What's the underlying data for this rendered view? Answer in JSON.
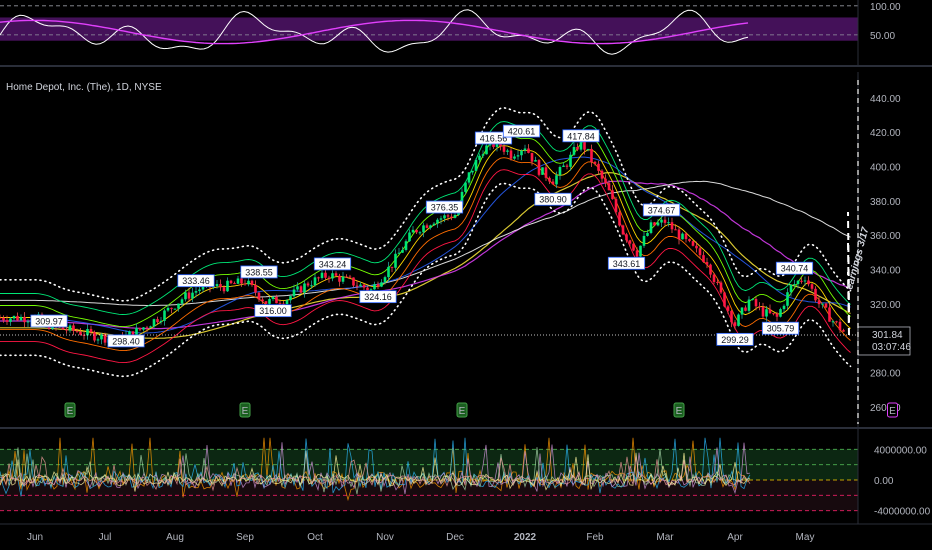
{
  "chart_data": [
    {
      "type": "line",
      "panel": "oscillator",
      "yticks": [
        50,
        100
      ],
      "band": [
        40,
        80
      ]
    },
    {
      "type": "candlestick",
      "panel": "price",
      "title": "Home Depot, Inc. (The), 1D, NYSE",
      "ylim": [
        250,
        455
      ],
      "yticks": [
        260,
        280,
        300,
        320,
        340,
        360,
        380,
        400,
        420,
        440
      ],
      "xticks": [
        "Jun",
        "Jul",
        "Aug",
        "Sep",
        "Oct",
        "Nov",
        "Dec",
        "2022",
        "Feb",
        "Mar",
        "Apr",
        "May"
      ],
      "last_price": {
        "value": 301.84,
        "label": "301.84",
        "countdown": "03:07:46"
      },
      "annotation": "earnings 3/17",
      "earnings_markers": [
        {
          "label": "E",
          "x": 0.5
        },
        {
          "label": "E",
          "x": 3.0
        },
        {
          "label": "E",
          "x": 6.1
        },
        {
          "label": "E",
          "x": 9.2
        },
        {
          "label": "E",
          "x": 12.25
        }
      ],
      "pivot_labels": [
        {
          "value": "309.97",
          "x": 0.2,
          "y": 309.97
        },
        {
          "value": "298.40",
          "x": 1.3,
          "y": 298.4
        },
        {
          "value": "333.46",
          "x": 2.3,
          "y": 333.46
        },
        {
          "value": "338.55",
          "x": 3.2,
          "y": 338.55
        },
        {
          "value": "316.00",
          "x": 3.4,
          "y": 316.0
        },
        {
          "value": "343.24",
          "x": 4.25,
          "y": 343.24
        },
        {
          "value": "324.16",
          "x": 4.9,
          "y": 324.16
        },
        {
          "value": "376.35",
          "x": 5.85,
          "y": 376.35
        },
        {
          "value": "416.56",
          "x": 6.55,
          "y": 416.56
        },
        {
          "value": "420.61",
          "x": 6.95,
          "y": 420.61
        },
        {
          "value": "417.84",
          "x": 7.8,
          "y": 417.84
        },
        {
          "value": "380.90",
          "x": 7.4,
          "y": 380.9
        },
        {
          "value": "374.67",
          "x": 8.95,
          "y": 374.67
        },
        {
          "value": "343.61",
          "x": 8.45,
          "y": 343.61
        },
        {
          "value": "299.29",
          "x": 10.0,
          "y": 299.29
        },
        {
          "value": "340.74",
          "x": 10.85,
          "y": 340.74
        },
        {
          "value": "305.79",
          "x": 10.65,
          "y": 305.79
        }
      ],
      "closes": [
        [
          0.0,
          312
        ],
        [
          0.3,
          306
        ],
        [
          0.6,
          304
        ],
        [
          0.9,
          301
        ],
        [
          1.2,
          299
        ],
        [
          1.5,
          305
        ],
        [
          1.8,
          313
        ],
        [
          2.1,
          323
        ],
        [
          2.4,
          330
        ],
        [
          2.7,
          330
        ],
        [
          3.0,
          333
        ],
        [
          3.3,
          321
        ],
        [
          3.6,
          323
        ],
        [
          3.9,
          332
        ],
        [
          4.2,
          337
        ],
        [
          4.5,
          333
        ],
        [
          4.8,
          328
        ],
        [
          5.1,
          343
        ],
        [
          5.4,
          362
        ],
        [
          5.7,
          369
        ],
        [
          6.0,
          372
        ],
        [
          6.2,
          395
        ],
        [
          6.4,
          410
        ],
        [
          6.6,
          414
        ],
        [
          6.8,
          407
        ],
        [
          7.0,
          412
        ],
        [
          7.2,
          398
        ],
        [
          7.4,
          392
        ],
        [
          7.6,
          402
        ],
        [
          7.8,
          415
        ],
        [
          8.0,
          400
        ],
        [
          8.2,
          385
        ],
        [
          8.4,
          362
        ],
        [
          8.6,
          350
        ],
        [
          8.8,
          365
        ],
        [
          9.0,
          368
        ],
        [
          9.2,
          360
        ],
        [
          9.4,
          352
        ],
        [
          9.6,
          345
        ],
        [
          9.8,
          325
        ],
        [
          10.0,
          308
        ],
        [
          10.2,
          322
        ],
        [
          10.4,
          315
        ],
        [
          10.6,
          312
        ],
        [
          10.8,
          330
        ],
        [
          11.0,
          336
        ],
        [
          11.2,
          320
        ],
        [
          11.4,
          310
        ],
        [
          11.6,
          301.84
        ]
      ]
    },
    {
      "type": "line",
      "panel": "volume-oscillator",
      "yticks": [
        -4000000,
        0,
        4000000
      ],
      "ytick_labels": [
        "-4000000.00",
        "0.00",
        "4000000.00"
      ]
    }
  ]
}
